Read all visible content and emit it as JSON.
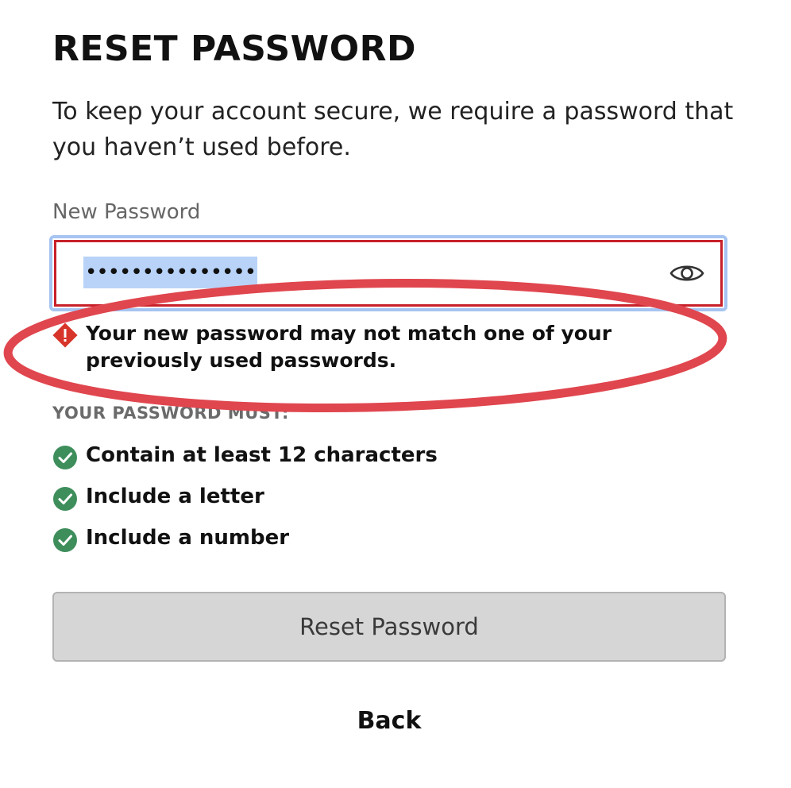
{
  "page": {
    "title": "RESET PASSWORD",
    "intro": "To keep your account secure, we require a password that you haven’t used before."
  },
  "password_field": {
    "label": "New Password",
    "value": "•••••••••••••••",
    "toggle_icon": "eye-icon"
  },
  "error": {
    "icon": "warning-diamond-icon",
    "message": "Your new password may not match one of your previously used passwords."
  },
  "requirements": {
    "heading": "YOUR PASSWORD MUST:",
    "items": [
      {
        "label": "Contain at least 12 characters",
        "met": true
      },
      {
        "label": "Include a letter",
        "met": true
      },
      {
        "label": "Include a number",
        "met": true
      }
    ]
  },
  "actions": {
    "reset_label": "Reset Password",
    "back_label": "Back"
  },
  "colors": {
    "error_red": "#c8202a",
    "focus_blue": "#a6c4f2",
    "check_green": "#3e8e5c",
    "annotation_red": "#e0464e"
  }
}
